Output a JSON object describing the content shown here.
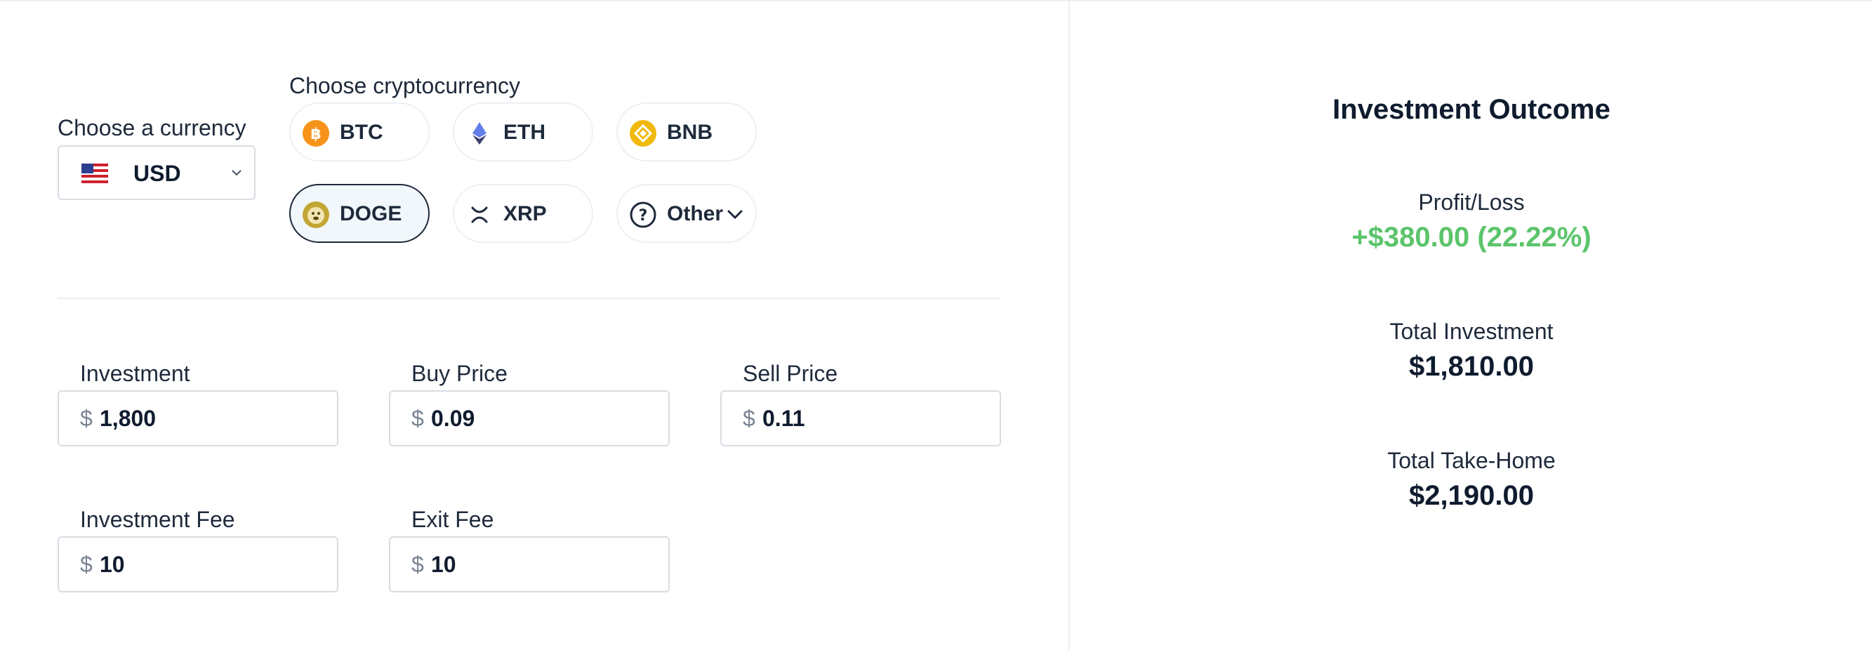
{
  "currency": {
    "label": "Choose a currency",
    "selected": "USD",
    "flag_icon": "us-flag-icon"
  },
  "crypto": {
    "label": "Choose cryptocurrency",
    "options": [
      {
        "label": "BTC",
        "icon": "bitcoin-icon",
        "color": "#f7931a"
      },
      {
        "label": "ETH",
        "icon": "ethereum-icon",
        "color": "#627eea"
      },
      {
        "label": "BNB",
        "icon": "bnb-icon",
        "color": "#f0b90b"
      },
      {
        "label": "DOGE",
        "icon": "dogecoin-icon",
        "color": "#c2a633",
        "selected": true
      },
      {
        "label": "XRP",
        "icon": "xrp-icon",
        "color": "#1e2a3b"
      },
      {
        "label": "Other",
        "icon": "question-circle-icon",
        "color": "#1e2a3b"
      }
    ]
  },
  "inputs": {
    "currency_symbol": "$",
    "investment": {
      "label": "Investment",
      "value": "1,800"
    },
    "buy_price": {
      "label": "Buy Price",
      "value": "0.09"
    },
    "sell_price": {
      "label": "Sell Price",
      "value": "0.11"
    },
    "investment_fee": {
      "label": "Investment Fee",
      "value": "10"
    },
    "exit_fee": {
      "label": "Exit Fee",
      "value": "10"
    }
  },
  "outcome": {
    "title": "Investment Outcome",
    "profit_loss": {
      "label": "Profit/Loss",
      "value": "+$380.00 (22.22%)",
      "color": "#5cc46b"
    },
    "total_investment": {
      "label": "Total Investment",
      "value": "$1,810.00"
    },
    "total_take_home": {
      "label": "Total Take-Home",
      "value": "$2,190.00"
    }
  }
}
